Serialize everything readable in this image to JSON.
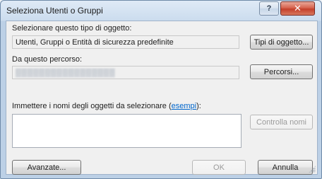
{
  "window": {
    "title": "Seleziona Utenti o Gruppi",
    "help_label": "?",
    "close_label": "✕"
  },
  "object_type": {
    "label": "Selezionare questo tipo di oggetto:",
    "value": "Utenti, Gruppi o Entità di sicurezza predefinite",
    "button_label": "Tipi di oggetto..."
  },
  "location": {
    "label": "Da questo percorso:",
    "value": "▒▒▒▒▒▒▒▒▒▒▒▒▒▒▒▒▒",
    "button_label": "Percorsi..."
  },
  "names": {
    "label_prefix": "Immettere i nomi degli oggetti da selezionare (",
    "label_link": "esempi",
    "label_suffix": "):",
    "value": "",
    "check_button_label": "Controlla nomi"
  },
  "footer": {
    "advanced_label": "Avanzate...",
    "ok_label": "OK",
    "cancel_label": "Annulla"
  }
}
